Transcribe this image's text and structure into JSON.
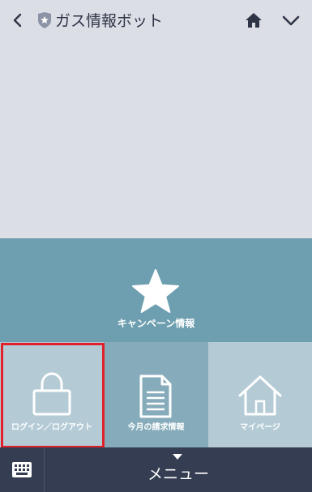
{
  "header": {
    "title": "ガス情報ボット",
    "back_icon": "chevron-left-icon",
    "badge_icon": "shield-star-icon",
    "home_icon": "home-icon",
    "dropdown_icon": "chevron-down-icon"
  },
  "rich_menu": {
    "banner": {
      "label": "キャンペーン情報",
      "icon": "star-icon"
    },
    "tiles": [
      {
        "label": "ログイン／ログアウト",
        "icon": "lock-icon",
        "highlighted": true
      },
      {
        "label": "今月の請求情報",
        "icon": "document-icon"
      },
      {
        "label": "マイページ",
        "icon": "house-outline-icon"
      }
    ],
    "highlight_color": "#e0202a"
  },
  "menubar": {
    "keyboard_icon": "keyboard-icon",
    "label": "メニュー",
    "toggle_icon": "caret-down-icon"
  },
  "colors": {
    "background": "#dcdee6",
    "banner": "#6e9fb0",
    "tile_light": "#b4cbd6",
    "tile_dark": "#86abba",
    "menubar": "#353d52"
  }
}
